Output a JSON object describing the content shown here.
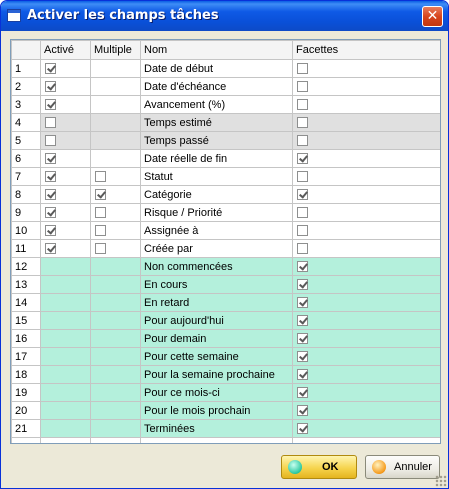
{
  "window": {
    "title": "Activer les champs tâches",
    "close_glyph": "✕"
  },
  "grid": {
    "columns": [
      "",
      "Activé",
      "Multiple",
      "Nom",
      "Facettes"
    ],
    "rows": [
      {
        "num": "1",
        "active": true,
        "multiple": null,
        "name": "Date de début",
        "facets": false,
        "style": "white"
      },
      {
        "num": "2",
        "active": true,
        "multiple": null,
        "name": "Date d'échéance",
        "facets": false,
        "style": "white"
      },
      {
        "num": "3",
        "active": true,
        "multiple": null,
        "name": "Avancement (%)",
        "facets": false,
        "style": "white"
      },
      {
        "num": "4",
        "active": false,
        "multiple": null,
        "name": "Temps estimé",
        "facets": false,
        "style": "grey"
      },
      {
        "num": "5",
        "active": false,
        "multiple": null,
        "name": "Temps passé",
        "facets": false,
        "style": "grey"
      },
      {
        "num": "6",
        "active": true,
        "multiple": null,
        "name": "Date réelle de fin",
        "facets": true,
        "style": "white"
      },
      {
        "num": "7",
        "active": true,
        "multiple": false,
        "name": "Statut",
        "facets": false,
        "style": "white"
      },
      {
        "num": "8",
        "active": true,
        "multiple": true,
        "name": "Catégorie",
        "facets": true,
        "style": "white"
      },
      {
        "num": "9",
        "active": true,
        "multiple": false,
        "name": "Risque / Priorité",
        "facets": false,
        "style": "white"
      },
      {
        "num": "10",
        "active": true,
        "multiple": false,
        "name": "Assignée à",
        "facets": false,
        "style": "white"
      },
      {
        "num": "11",
        "active": true,
        "multiple": false,
        "name": "Créée par",
        "facets": false,
        "style": "white"
      },
      {
        "num": "12",
        "active": null,
        "multiple": null,
        "name": "Non commencées",
        "facets": true,
        "style": "teal"
      },
      {
        "num": "13",
        "active": null,
        "multiple": null,
        "name": "En cours",
        "facets": true,
        "style": "teal"
      },
      {
        "num": "14",
        "active": null,
        "multiple": null,
        "name": "En retard",
        "facets": true,
        "style": "teal"
      },
      {
        "num": "15",
        "active": null,
        "multiple": null,
        "name": "Pour aujourd'hui",
        "facets": true,
        "style": "teal"
      },
      {
        "num": "16",
        "active": null,
        "multiple": null,
        "name": "Pour demain",
        "facets": true,
        "style": "teal"
      },
      {
        "num": "17",
        "active": null,
        "multiple": null,
        "name": "Pour cette semaine",
        "facets": true,
        "style": "teal"
      },
      {
        "num": "18",
        "active": null,
        "multiple": null,
        "name": "Pour la semaine prochaine",
        "facets": true,
        "style": "teal"
      },
      {
        "num": "19",
        "active": null,
        "multiple": null,
        "name": "Pour ce mois-ci",
        "facets": true,
        "style": "teal"
      },
      {
        "num": "20",
        "active": null,
        "multiple": null,
        "name": "Pour le mois prochain",
        "facets": true,
        "style": "teal"
      },
      {
        "num": "21",
        "active": null,
        "multiple": null,
        "name": "Terminées",
        "facets": true,
        "style": "teal"
      }
    ]
  },
  "buttons": {
    "ok_label": "OK",
    "cancel_label": "Annuler"
  },
  "colors": {
    "teal_row": "#b4f0dc",
    "grey_row": "#e0e0e0",
    "titlebar": "#0a50d8"
  }
}
